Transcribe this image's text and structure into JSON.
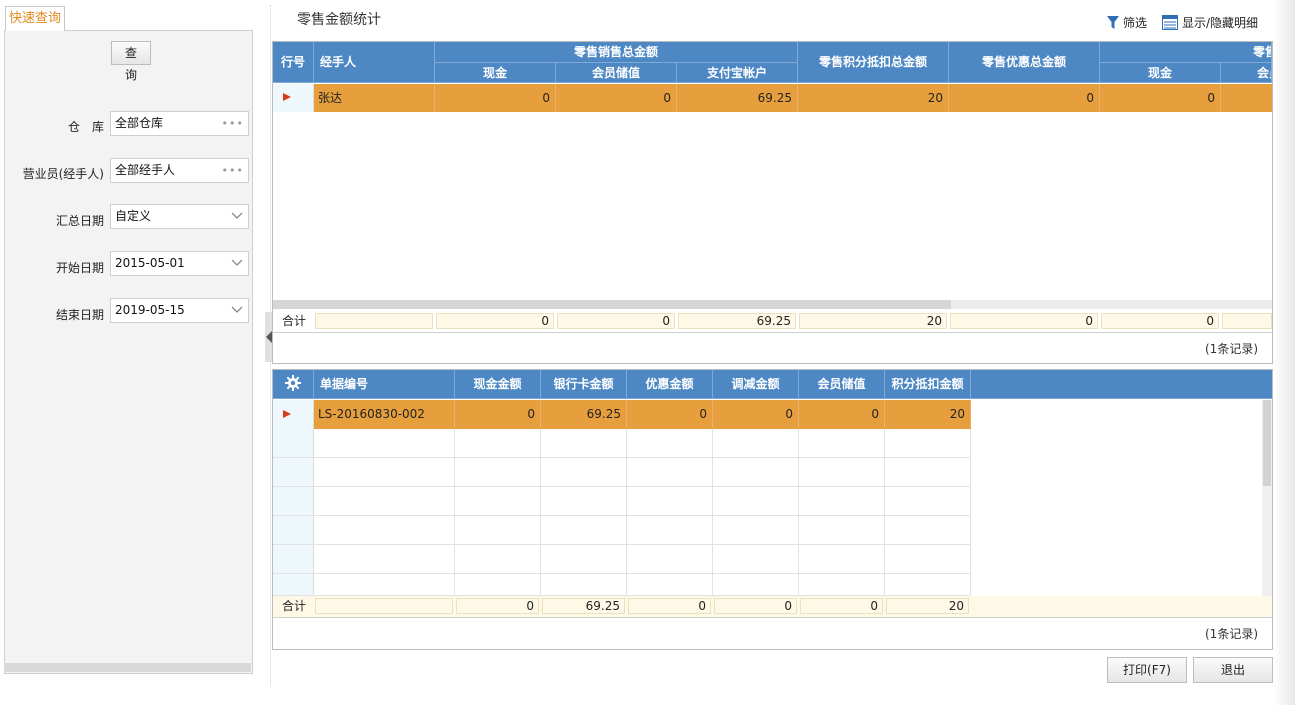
{
  "quick_query": {
    "tab_label": "快速查询",
    "query_button": "查 询",
    "fields": [
      {
        "label": "仓　库",
        "value": "全部仓库",
        "control": "picker"
      },
      {
        "label": "营业员(经手人)",
        "value": "全部经手人",
        "control": "picker"
      },
      {
        "label": "汇总日期",
        "value": "自定义",
        "control": "dropdown"
      },
      {
        "label": "开始日期",
        "value": "2015-05-01",
        "control": "dropdown"
      },
      {
        "label": "结束日期",
        "value": "2019-05-15",
        "control": "dropdown"
      }
    ]
  },
  "header": {
    "title": "零售金额统计",
    "filter_label": "筛选",
    "toggle_detail_label": "显示/隐藏明细"
  },
  "summary_grid": {
    "group_headers": {
      "rownum": "行号",
      "handler": "经手人",
      "retail_total": "零售销售总金额",
      "points_total": "零售积分抵扣总金额",
      "discount_total": "零售优惠总金额",
      "return_total": "零售退"
    },
    "sub_headers": [
      "现金",
      "会员储值",
      "支付宝帐户",
      "现金",
      "会员"
    ],
    "rows": [
      {
        "handler": "张达",
        "cash": "0",
        "member_balance": "0",
        "alipay": "69.25",
        "points": "20",
        "discount": "0",
        "return_cash": "0"
      }
    ],
    "totals": {
      "label": "合计",
      "cash": "0",
      "member_balance": "0",
      "alipay": "69.25",
      "points": "20",
      "discount": "0",
      "return_cash": "0"
    },
    "record_count": "(1条记录)"
  },
  "detail_grid": {
    "headers": [
      "单据编号",
      "现金金额",
      "银行卡金额",
      "优惠金额",
      "调减金额",
      "会员储值",
      "积分抵扣金额"
    ],
    "rows": [
      {
        "doc_no": "LS-20160830-002",
        "cash": "0",
        "bank_card": "69.25",
        "discount": "0",
        "deduction": "0",
        "member_balance": "0",
        "points": "20"
      }
    ],
    "totals": {
      "label": "合计",
      "cash": "0",
      "bank_card": "69.25",
      "discount": "0",
      "deduction": "0",
      "member_balance": "0",
      "points": "20"
    },
    "record_count": "(1条记录)"
  },
  "footer": {
    "print_button": "打印(F7)",
    "exit_button": "退出"
  },
  "colors": {
    "header_blue": "#4d88c4",
    "selected_row": "#e69f3c",
    "tab_orange": "#e08a1e",
    "totals_bg": "#fdf9e6"
  }
}
